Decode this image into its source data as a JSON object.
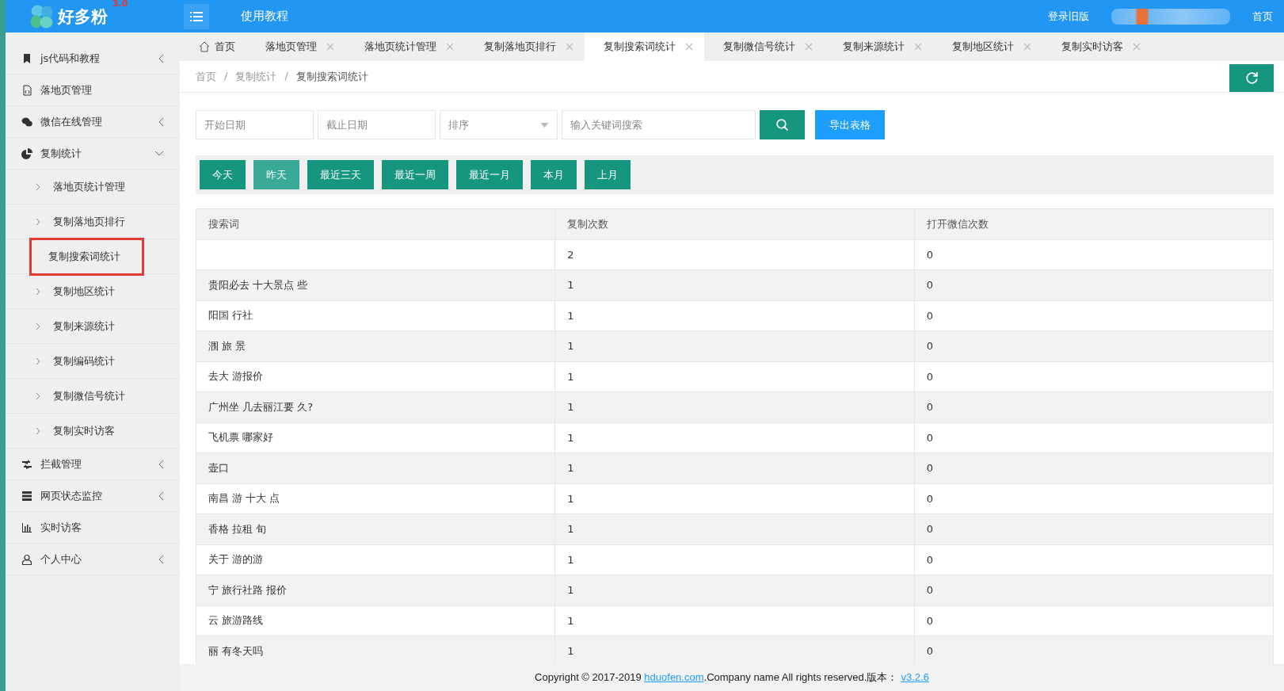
{
  "header": {
    "logo_text": "好多粉",
    "logo_version": "3.0",
    "nav_link": "使用教程",
    "right_links": [
      "登录旧版",
      "首页"
    ]
  },
  "sidebar": {
    "items": [
      {
        "label": "js代码和教程",
        "expanded": false
      },
      {
        "label": "落地页管理"
      },
      {
        "label": "微信在线管理",
        "expanded": false
      },
      {
        "label": "复制统计",
        "expanded": true,
        "children": [
          {
            "label": "落地页统计管理",
            "selected": false
          },
          {
            "label": "复制落地页排行",
            "selected": false
          },
          {
            "label": "复制搜索词统计",
            "selected": true
          },
          {
            "label": "复制地区统计",
            "selected": false
          },
          {
            "label": "复制来源统计",
            "selected": false
          },
          {
            "label": "复制编码统计",
            "selected": false
          },
          {
            "label": "复制微信号统计",
            "selected": false
          },
          {
            "label": "复制实时访客",
            "selected": false
          }
        ]
      },
      {
        "label": "拦截管理",
        "expanded": false
      },
      {
        "label": "网页状态监控",
        "expanded": false
      },
      {
        "label": "实时访客"
      },
      {
        "label": "个人中心",
        "expanded": false
      }
    ]
  },
  "tabs": [
    {
      "label": "首页",
      "kind": "home",
      "selected": false
    },
    {
      "label": "落地页管理",
      "kind": "page",
      "selected": false
    },
    {
      "label": "落地页统计管理",
      "kind": "page",
      "selected": false
    },
    {
      "label": "复制落地页排行",
      "kind": "page",
      "selected": false
    },
    {
      "label": "复制搜索词统计",
      "kind": "page",
      "selected": true
    },
    {
      "label": "复制微信号统计",
      "kind": "page",
      "selected": false
    },
    {
      "label": "复制来源统计",
      "kind": "page",
      "selected": false
    },
    {
      "label": "复制地区统计",
      "kind": "page",
      "selected": false
    },
    {
      "label": "复制实时访客",
      "kind": "page",
      "selected": false
    }
  ],
  "breadcrumb": {
    "separator": "/",
    "items": [
      "首页",
      "复制统计",
      "复制搜索词统计"
    ]
  },
  "filters": {
    "start_date": {
      "placeholder": "开始日期"
    },
    "end_date": {
      "placeholder": "截止日期"
    },
    "sort": {
      "placeholder": "排序"
    },
    "keyword": {
      "placeholder": "输入关键词搜索"
    },
    "export_button": "导出表格"
  },
  "quick_ranges": [
    {
      "label": "今天",
      "selected": false
    },
    {
      "label": "昨天",
      "selected": true
    },
    {
      "label": "最近三天",
      "selected": false
    },
    {
      "label": "最近一周",
      "selected": false
    },
    {
      "label": "最近一月",
      "selected": false
    },
    {
      "label": "本月",
      "selected": false
    },
    {
      "label": "上月",
      "selected": false
    }
  ],
  "table": {
    "columns": [
      "搜索词",
      "复制次数",
      "打开微信次数"
    ],
    "rows": [
      [
        "",
        "2",
        "0"
      ],
      [
        "贵阳必去 十大景点 些",
        "1",
        "0"
      ],
      [
        "阳国 行社",
        "1",
        "0"
      ],
      [
        "涠 旅 景",
        "1",
        "0"
      ],
      [
        "去大 游报价",
        "1",
        "0"
      ],
      [
        "广州坐 几去丽江要 久?",
        "1",
        "0"
      ],
      [
        "飞机票 哪家好",
        "1",
        "0"
      ],
      [
        "壶口",
        "1",
        "0"
      ],
      [
        "南昌 游 十大 点",
        "1",
        "0"
      ],
      [
        "香格 拉租 旬",
        "1",
        "0"
      ],
      [
        "关于 游的游",
        "1",
        "0"
      ],
      [
        "宁 旅行社路 报价",
        "1",
        "0"
      ],
      [
        "云 旅游路线",
        "1",
        "0"
      ],
      [
        "丽 有冬天吗",
        "1",
        "0"
      ]
    ]
  },
  "footer": {
    "text_before": "Copyright © 2017-2019 ",
    "site_link": "hduofen.com",
    "text_middle": ".Company name All rights reserved.版本：",
    "version_link": "v3.2.6"
  }
}
